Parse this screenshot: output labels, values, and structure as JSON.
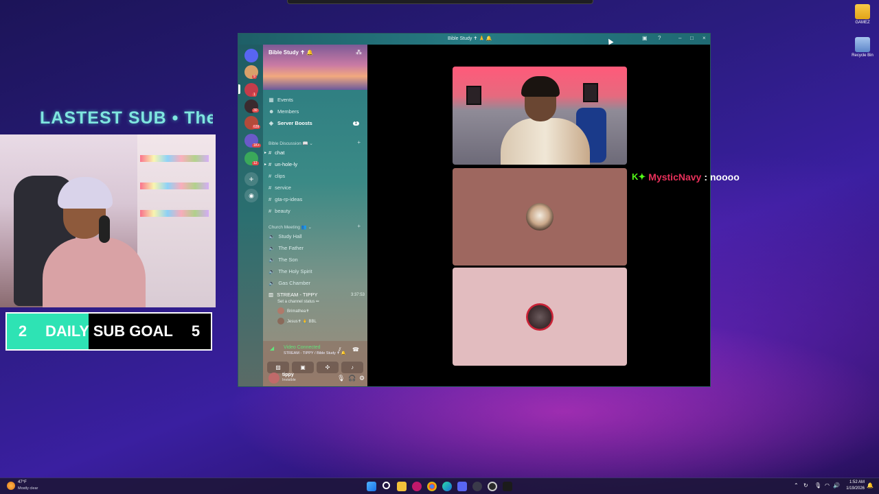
{
  "overlay": {
    "latest_sub": "LASTEST SUB • The",
    "sub_goal": {
      "current": "2",
      "label": "DAILY SUB GOAL",
      "target": "5",
      "progress_fraction": 0.4
    }
  },
  "desktop": {
    "icons": [
      {
        "label": "GAMEZ",
        "icon": "folder-icon"
      },
      {
        "label": "Recycle Bin",
        "icon": "recycle-bin-icon"
      }
    ]
  },
  "discord": {
    "window_title": "Bible Study ✝ 🙏 🔔",
    "server_name": "Bible Study ✝ 🔔",
    "rail_badges": [
      "9",
      "1",
      "2",
      "30",
      "639",
      "1K+",
      "12"
    ],
    "nav": [
      {
        "label": "Events",
        "icon": "calendar-icon"
      },
      {
        "label": "Members",
        "icon": "members-icon"
      },
      {
        "label": "Server Boosts",
        "icon": "boost-icon",
        "count": "1"
      }
    ],
    "category_discussion": "Bible Discussion 📖",
    "text_channels": [
      "chat",
      "un-hole-ly",
      "clips",
      "service",
      "gta-rp-ideas",
      "beauty"
    ],
    "category_meeting": "Church Meeting 👥",
    "voice_channels": [
      "Study Hall",
      "The Father",
      "The Son",
      "The Holy Spirit",
      "Gas Chamber"
    ],
    "stream_channel": {
      "name": "STREAM - TIPPY",
      "time": "3:37:53",
      "status": "Set a channel status ✏"
    },
    "voice_members": [
      "Brimathea✝",
      "Jesus✝ 🙏 BBL"
    ],
    "voice_connected": {
      "status": "Video Connected",
      "detail": "STREAM - TIPPY / Bible Study ✝ 🔔"
    },
    "user": {
      "name": "tippy",
      "status": "Invisible"
    }
  },
  "chat": {
    "user": "MysticNavy",
    "separator": ":",
    "message": "noooo"
  },
  "taskbar": {
    "temp": "47°F",
    "condition": "Mostly clear",
    "time": "1:52 AM",
    "date": "1/19/2026"
  },
  "colors": {
    "goal_fill": "#2ee3b4",
    "voice_connected": "#63e47c",
    "chat_user": "#e8305a",
    "kick_green": "#53fc18"
  }
}
